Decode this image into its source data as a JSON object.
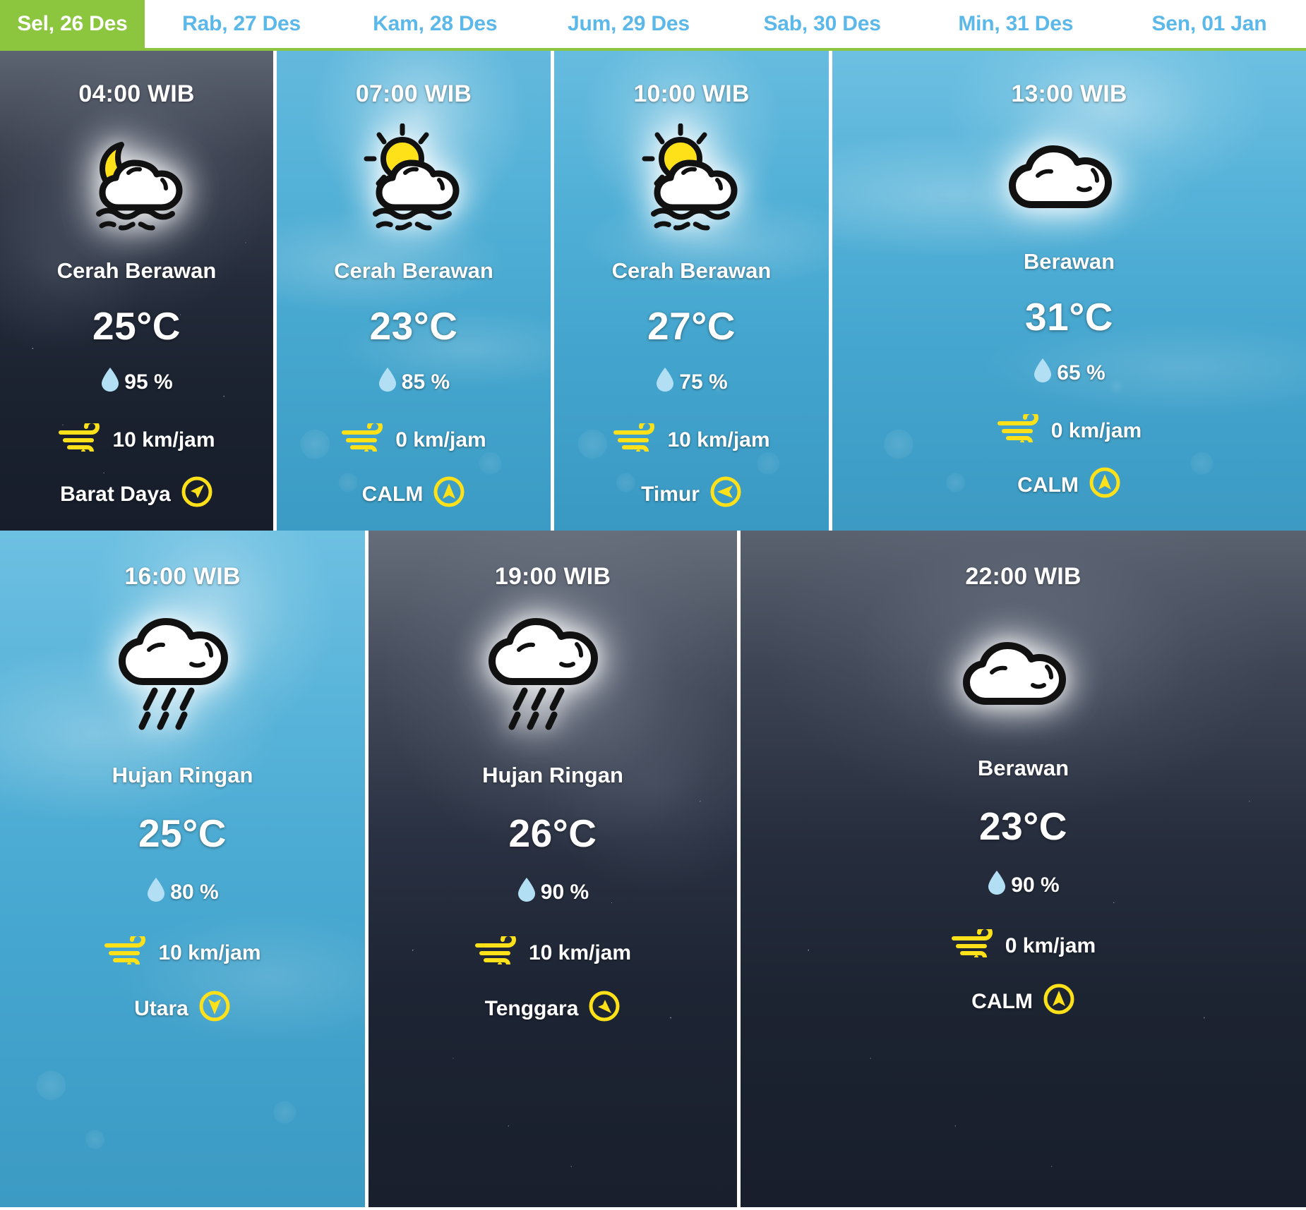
{
  "tabs": [
    {
      "label": "Sel, 26 Des",
      "active": true
    },
    {
      "label": "Rab, 27 Des",
      "active": false
    },
    {
      "label": "Kam, 28 Des",
      "active": false
    },
    {
      "label": "Jum, 29 Des",
      "active": false
    },
    {
      "label": "Sab, 30 Des",
      "active": false
    },
    {
      "label": "Min, 31 Des",
      "active": false
    },
    {
      "label": "Sen, 01 Jan",
      "active": false
    }
  ],
  "theme": {
    "accent_green": "#8cc63f",
    "tab_inactive_blue": "#5bb8e8",
    "wind_yellow": "#ffe11a",
    "humidity_blue": "#b3dff5",
    "card_white": "#ffffff"
  },
  "forecasts": [
    {
      "time": "04:00 WIB",
      "condition": "Cerah Berawan",
      "temperature": "25°C",
      "humidity": "95 %",
      "wind_speed": "10 km/jam",
      "wind_direction": "Barat Daya",
      "icon": "moon-behind-cloud-haze-icon",
      "wind_arrow": "arrow-northeast-icon"
    },
    {
      "time": "07:00 WIB",
      "condition": "Cerah Berawan",
      "temperature": "23°C",
      "humidity": "85 %",
      "wind_speed": "0 km/jam",
      "wind_direction": "CALM",
      "icon": "sun-behind-cloud-haze-icon",
      "wind_arrow": "arrow-north-icon"
    },
    {
      "time": "10:00 WIB",
      "condition": "Cerah Berawan",
      "temperature": "27°C",
      "humidity": "75 %",
      "wind_speed": "10 km/jam",
      "wind_direction": "Timur",
      "icon": "sun-behind-cloud-haze-icon",
      "wind_arrow": "arrow-west-icon"
    },
    {
      "time": "13:00 WIB",
      "condition": "Berawan",
      "temperature": "31°C",
      "humidity": "65 %",
      "wind_speed": "0 km/jam",
      "wind_direction": "CALM",
      "icon": "cloud-icon",
      "wind_arrow": "arrow-north-icon"
    },
    {
      "time": "16:00 WIB",
      "condition": "Hujan Ringan",
      "temperature": "25°C",
      "humidity": "80 %",
      "wind_speed": "10 km/jam",
      "wind_direction": "Utara",
      "icon": "rain-cloud-icon",
      "wind_arrow": "arrow-south-icon"
    },
    {
      "time": "19:00 WIB",
      "condition": "Hujan Ringan",
      "temperature": "26°C",
      "humidity": "90 %",
      "wind_speed": "10 km/jam",
      "wind_direction": "Tenggara",
      "icon": "rain-cloud-icon",
      "wind_arrow": "arrow-southeast-icon"
    },
    {
      "time": "22:00 WIB",
      "condition": "Berawan",
      "temperature": "23°C",
      "humidity": "90 %",
      "wind_speed": "0 km/jam",
      "wind_direction": "CALM",
      "icon": "cloud-icon",
      "wind_arrow": "arrow-north-icon"
    }
  ]
}
